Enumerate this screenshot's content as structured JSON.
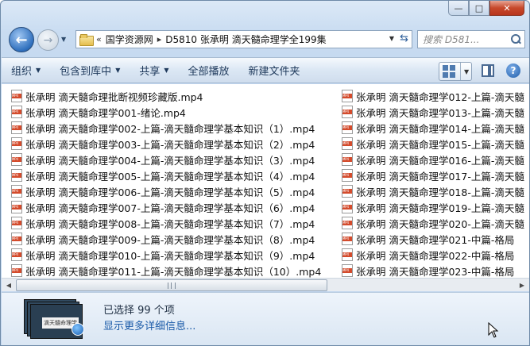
{
  "window": {
    "caption": {
      "minimize": "—",
      "maximize": "□",
      "close": "✕"
    }
  },
  "nav": {
    "back_icon": "back-arrow-icon",
    "forward_icon": "forward-arrow-icon",
    "crumb_overflow": "«",
    "breadcrumbs": [
      "国学资源网",
      "D5810 张承明 滴天髓命理学全199集"
    ],
    "search_placeholder": "搜索 D581..."
  },
  "toolbar": {
    "organize": "组织",
    "include_library": "包含到库中",
    "share": "共享",
    "play_all": "全部播放",
    "new_folder": "新建文件夹"
  },
  "files_col1": [
    "张承明 滴天髓命理批断视频珍藏版.mp4",
    "张承明 滴天髓命理学001-绪论.mp4",
    "张承明 滴天髓命理学002-上篇-滴天髓命理学基本知识（1）.mp4",
    "张承明 滴天髓命理学003-上篇-滴天髓命理学基本知识（2）.mp4",
    "张承明 滴天髓命理学004-上篇-滴天髓命理学基本知识（3）.mp4",
    "张承明 滴天髓命理学005-上篇-滴天髓命理学基本知识（4）.mp4",
    "张承明 滴天髓命理学006-上篇-滴天髓命理学基本知识（5）.mp4",
    "张承明 滴天髓命理学007-上篇-滴天髓命理学基本知识（6）.mp4",
    "张承明 滴天髓命理学008-上篇-滴天髓命理学基本知识（7）.mp4",
    "张承明 滴天髓命理学009-上篇-滴天髓命理学基本知识（8）.mp4",
    "张承明 滴天髓命理学010-上篇-滴天髓命理学基本知识（9）.mp4",
    "张承明 滴天髓命理学011-上篇-滴天髓命理学基本知识（10）.mp4"
  ],
  "files_col2": [
    "张承明 滴天髓命理学012-上篇-滴天髓",
    "张承明 滴天髓命理学013-上篇-滴天髓",
    "张承明 滴天髓命理学014-上篇-滴天髓",
    "张承明 滴天髓命理学015-上篇-滴天髓",
    "张承明 滴天髓命理学016-上篇-滴天髓",
    "张承明 滴天髓命理学017-上篇-滴天髓",
    "张承明 滴天髓命理学018-上篇-滴天髓",
    "张承明 滴天髓命理学019-上篇-滴天髓",
    "张承明 滴天髓命理学020-上篇-滴天髓",
    "张承明 滴天髓命理学021-中篇-格局",
    "张承明 滴天髓命理学022-中篇-格局",
    "张承明 滴天髓命理学023-中篇-格局"
  ],
  "details": {
    "selection": "已选择 99 个项",
    "more_details": "显示更多详细信息...",
    "thumb_text": "滴天髓命理学"
  },
  "colors": {
    "accent": "#1a5aa8",
    "mp4_badge": "#d44b2c"
  }
}
